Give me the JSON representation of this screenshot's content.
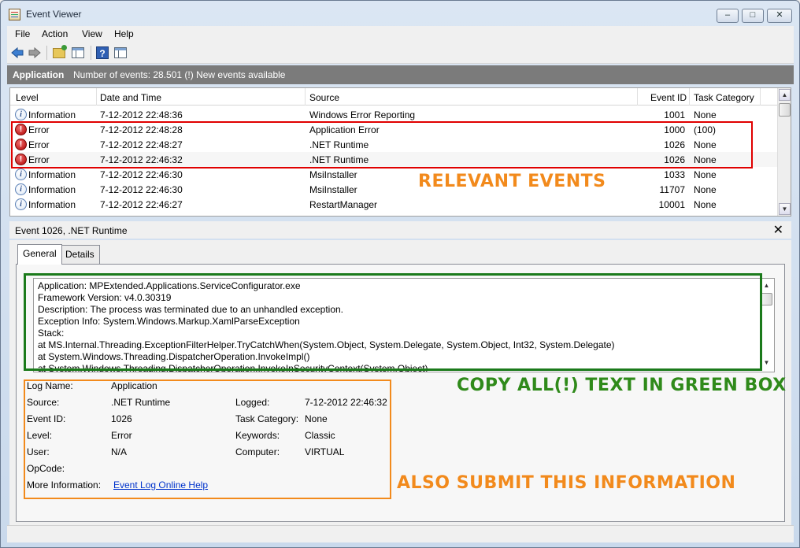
{
  "window": {
    "title": "Event Viewer",
    "min": "–",
    "max": "□",
    "close": "✕"
  },
  "menu": [
    "File",
    "Action",
    "View",
    "Help"
  ],
  "log_header": {
    "name": "Application",
    "count_text": "Number of events: 28.501 (!) New events available"
  },
  "columns": [
    "Level",
    "Date and Time",
    "Source",
    "Event ID",
    "Task Category"
  ],
  "events": [
    {
      "level": "Information",
      "icon": "info",
      "date": "7-12-2012 22:48:36",
      "source": "Windows Error Reporting",
      "id": "1001",
      "category": "None"
    },
    {
      "level": "Error",
      "icon": "error",
      "date": "7-12-2012 22:48:28",
      "source": "Application Error",
      "id": "1000",
      "category": "(100)"
    },
    {
      "level": "Error",
      "icon": "error",
      "date": "7-12-2012 22:48:27",
      "source": ".NET Runtime",
      "id": "1026",
      "category": "None"
    },
    {
      "level": "Error",
      "icon": "error",
      "date": "7-12-2012 22:46:32",
      "source": ".NET Runtime",
      "id": "1026",
      "category": "None"
    },
    {
      "level": "Information",
      "icon": "info",
      "date": "7-12-2012 22:46:30",
      "source": "MsiInstaller",
      "id": "1033",
      "category": "None"
    },
    {
      "level": "Information",
      "icon": "info",
      "date": "7-12-2012 22:46:30",
      "source": "MsiInstaller",
      "id": "11707",
      "category": "None"
    },
    {
      "level": "Information",
      "icon": "info",
      "date": "7-12-2012 22:46:27",
      "source": "RestartManager",
      "id": "10001",
      "category": "None"
    }
  ],
  "annotations": {
    "relevant": "RELEVANT EVENTS",
    "copy": "COPY ALL(!) TEXT IN GREEN BOX",
    "submit": "ALSO SUBMIT THIS INFORMATION",
    "colors": {
      "red": "#e00000",
      "green": "#1b7a1b",
      "orange": "#f28a1c"
    }
  },
  "detail": {
    "title": "Event 1026, .NET Runtime",
    "tabs": [
      "General",
      "Details"
    ],
    "description": [
      "Application: MPExtended.Applications.ServiceConfigurator.exe",
      "Framework Version: v4.0.30319",
      "Description: The process was terminated due to an unhandled exception.",
      "Exception Info: System.Windows.Markup.XamlParseException",
      "Stack:",
      "   at MS.Internal.Threading.ExceptionFilterHelper.TryCatchWhen(System.Object, System.Delegate, System.Object, Int32, System.Delegate)",
      "   at System.Windows.Threading.DispatcherOperation.InvokeImpl()",
      "   at System.Windows.Threading.DispatcherOperation.InvokeInSecurityContext(System.Object)"
    ],
    "props": {
      "log_name_label": "Log Name:",
      "log_name": "Application",
      "source_label": "Source:",
      "source": ".NET Runtime",
      "logged_label": "Logged:",
      "logged": "7-12-2012 22:46:32",
      "event_id_label": "Event ID:",
      "event_id": "1026",
      "task_category_label": "Task Category:",
      "task_category": "None",
      "level_label": "Level:",
      "level": "Error",
      "keywords_label": "Keywords:",
      "keywords": "Classic",
      "user_label": "User:",
      "user": "N/A",
      "computer_label": "Computer:",
      "computer": "VIRTUAL",
      "opcode_label": "OpCode:",
      "more_info_label": "More Information:",
      "more_info_link": "Event Log Online Help"
    }
  }
}
